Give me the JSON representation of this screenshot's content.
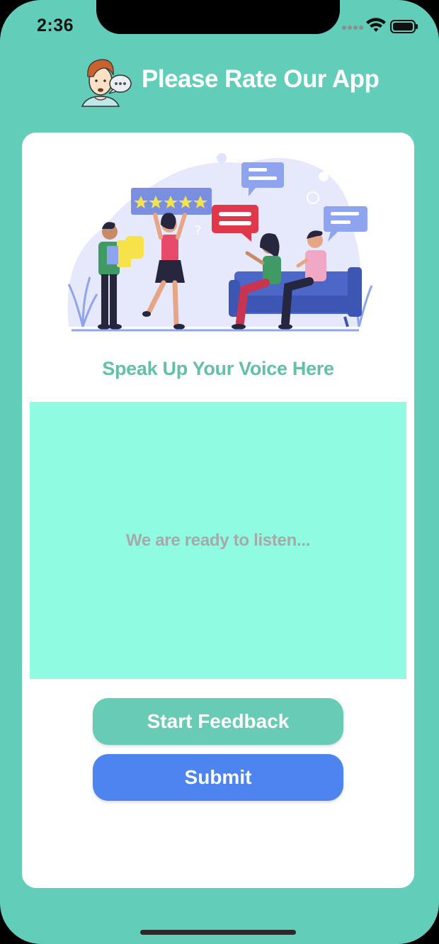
{
  "status_bar": {
    "time": "2:36",
    "signal_icon": "cellular-dots-icon",
    "wifi_icon": "wifi-icon",
    "battery_icon": "battery-icon"
  },
  "header": {
    "title": "Please Rate Our App",
    "avatar_icon": "person-speech-bubble-icon"
  },
  "card": {
    "illustration": "people-giving-feedback-illustration",
    "subtitle": "Speak Up Your Voice Here",
    "listen_placeholder": "We are ready to listen...",
    "start_button_label": "Start Feedback",
    "submit_button_label": "Submit"
  },
  "colors": {
    "background": "#62cdb8",
    "card": "#ffffff",
    "listen_panel": "#8ffce2",
    "subtitle": "#62bfa8",
    "start_button": "#68cbb5",
    "submit_button": "#4d84ef"
  }
}
